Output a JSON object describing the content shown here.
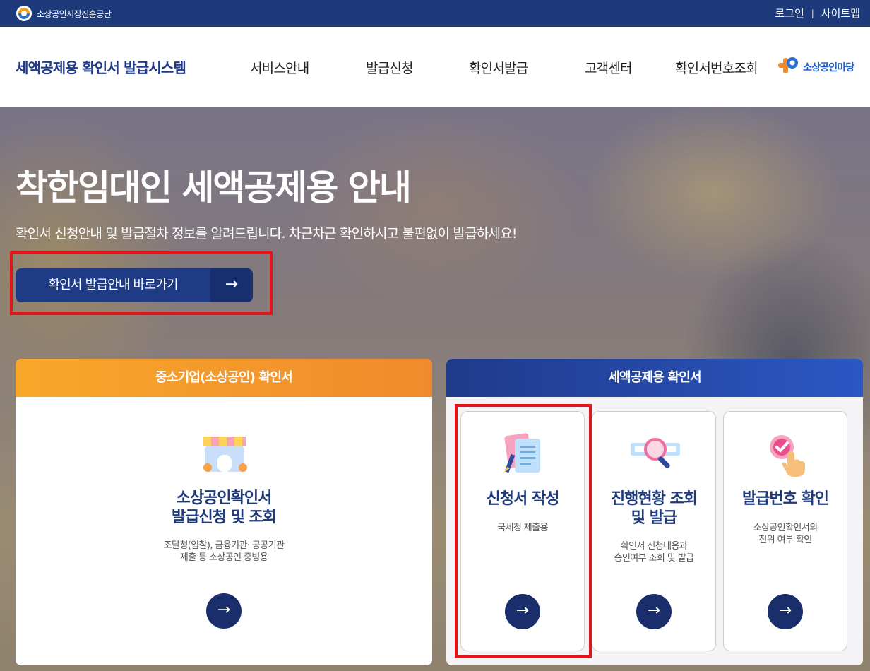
{
  "topbar": {
    "org_name": "소상공인시장진흥공단",
    "login": "로그인",
    "separator": "|",
    "sitemap": "사이트맵"
  },
  "header": {
    "site_title": "세액공제용 확인서 발급시스템",
    "nav": [
      "서비스안내",
      "발급신청",
      "확인서발급",
      "고객센터",
      "확인서번호조회"
    ],
    "brand": "소상공인마당"
  },
  "hero": {
    "title": "착한임대인 세액공제용 안내",
    "subtitle": "확인서 신청안내 및 발급절차 정보를 알려드립니다. 차근차근 확인하시고 불편없이 발급하세요!",
    "button_label": "확인서 발급안내 바로가기",
    "button_arrow": "→"
  },
  "left_panel": {
    "header": "중소기업(소상공인) 확인서",
    "icon": "store-icon",
    "title_line1": "소상공인확인서",
    "title_line2": "발급신청 및 조회",
    "desc_line1": "조달청(입찰), 금융기관· 공공기관",
    "desc_line2": "제출 등 소상공인 증빙용",
    "arrow": "→"
  },
  "right_panel": {
    "header": "세액공제용 확인서",
    "cards": [
      {
        "icon": "document-pen-icon",
        "title_line1": "신청서 작성",
        "title_line2": "",
        "desc_line1": "국세청 제출용",
        "desc_line2": "",
        "arrow": "→"
      },
      {
        "icon": "magnifier-icon",
        "title_line1": "진행현황 조회",
        "title_line2": "및 발급",
        "desc_line1": "확인서 신청내용과",
        "desc_line2": "승인여부 조회 및 발급",
        "arrow": "→"
      },
      {
        "icon": "check-hand-icon",
        "title_line1": "발급번호 확인",
        "title_line2": "",
        "desc_line1": "소상공인확인서의",
        "desc_line2": "진위 여부 확인",
        "arrow": "→"
      }
    ]
  },
  "colors": {
    "topbar": "#1f3a7a",
    "brand_blue": "#1f3a8a",
    "orange": "#f39a2b",
    "highlight_red": "#e3151a"
  }
}
